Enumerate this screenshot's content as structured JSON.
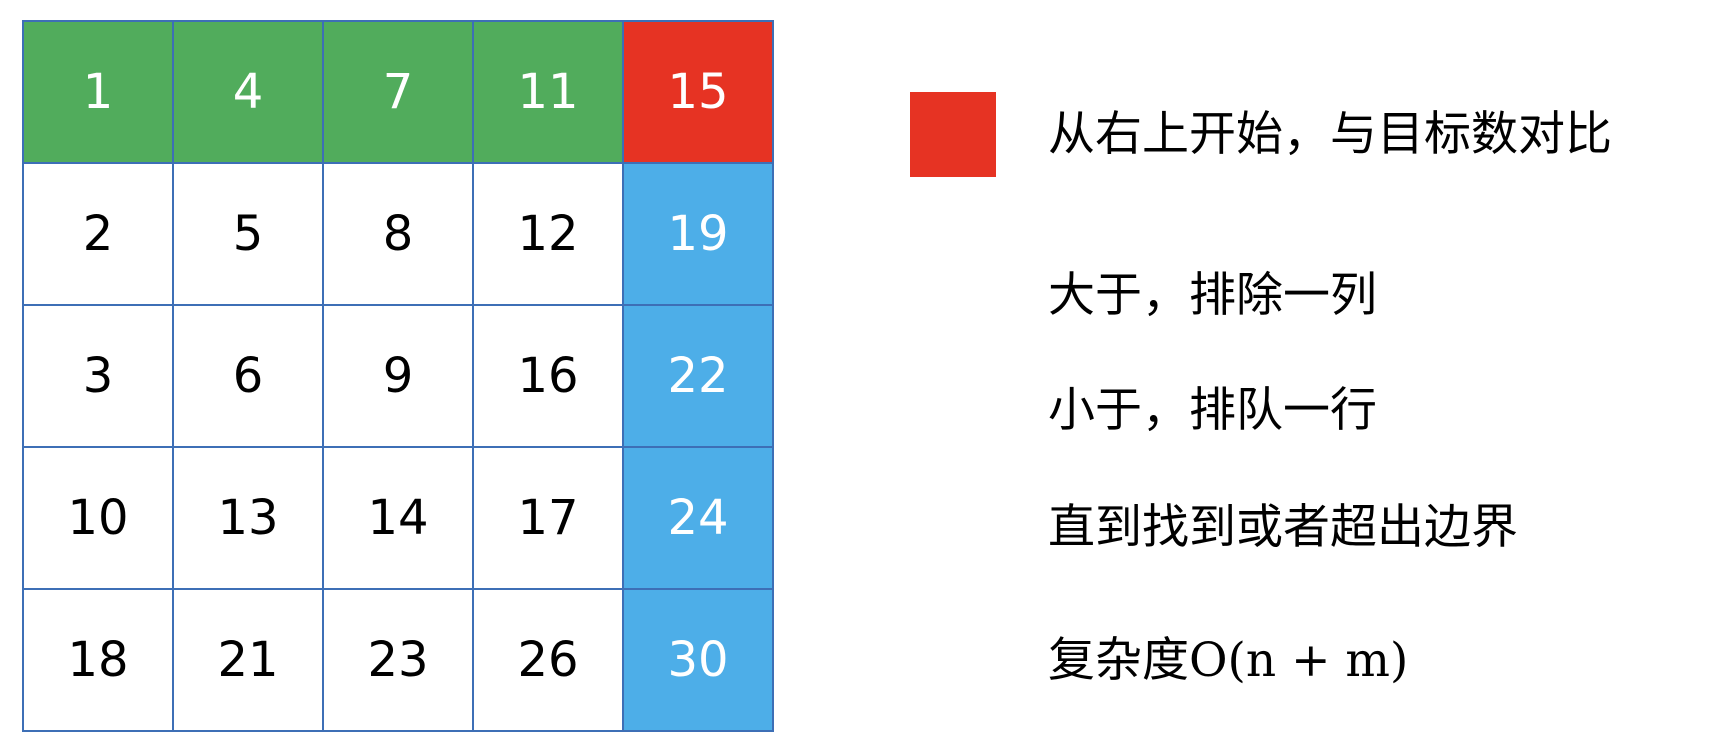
{
  "matrix": {
    "rows": [
      [
        {
          "value": "1",
          "state": "green"
        },
        {
          "value": "4",
          "state": "green"
        },
        {
          "value": "7",
          "state": "green"
        },
        {
          "value": "11",
          "state": "green"
        },
        {
          "value": "15",
          "state": "red"
        }
      ],
      [
        {
          "value": "2",
          "state": "white"
        },
        {
          "value": "5",
          "state": "white"
        },
        {
          "value": "8",
          "state": "white"
        },
        {
          "value": "12",
          "state": "white"
        },
        {
          "value": "19",
          "state": "blue"
        }
      ],
      [
        {
          "value": "3",
          "state": "white"
        },
        {
          "value": "6",
          "state": "white"
        },
        {
          "value": "9",
          "state": "white"
        },
        {
          "value": "16",
          "state": "white"
        },
        {
          "value": "22",
          "state": "blue"
        }
      ],
      [
        {
          "value": "10",
          "state": "white"
        },
        {
          "value": "13",
          "state": "white"
        },
        {
          "value": "14",
          "state": "white"
        },
        {
          "value": "17",
          "state": "white"
        },
        {
          "value": "24",
          "state": "blue"
        }
      ],
      [
        {
          "value": "18",
          "state": "white"
        },
        {
          "value": "21",
          "state": "white"
        },
        {
          "value": "23",
          "state": "white"
        },
        {
          "value": "26",
          "state": "white"
        },
        {
          "value": "30",
          "state": "blue"
        }
      ]
    ]
  },
  "colors": {
    "green": "#51ac5c",
    "red": "#e63323",
    "blue": "#4daee8",
    "border": "#3d6fb6"
  },
  "legend": {
    "swatch_color": "#e63323",
    "start_text": "从右上开始，与目标数对比"
  },
  "notes": {
    "greater": "大于，排除一列",
    "less": "小于，排队一行",
    "until": "直到找到或者超出边界",
    "complexity_prefix": "复杂度",
    "complexity_formula": "O(n + m)"
  }
}
